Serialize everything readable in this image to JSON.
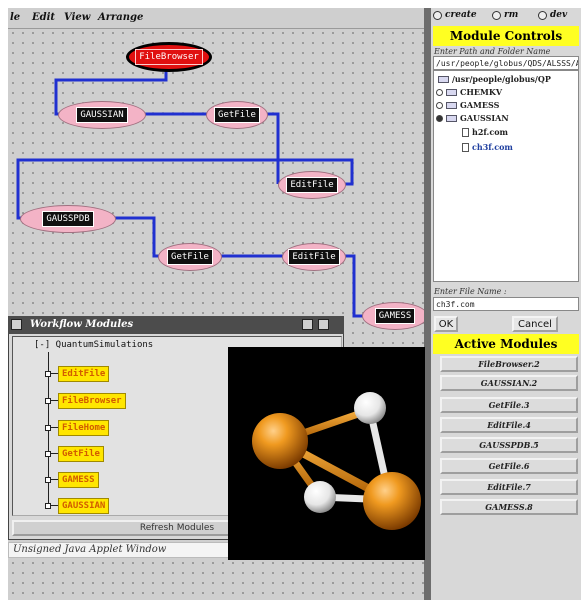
{
  "menubar": {
    "items": [
      "le",
      "Edit",
      "View",
      "Arrange"
    ]
  },
  "workflow_nodes": [
    {
      "id": "root",
      "label": "FileBrowser"
    },
    {
      "id": "n1",
      "label": "GAUSSIAN"
    },
    {
      "id": "n2",
      "label": "GetFile"
    },
    {
      "id": "n3",
      "label": "EditFile"
    },
    {
      "id": "n4",
      "label": "GAUSSPDB"
    },
    {
      "id": "n5",
      "label": "GetFile"
    },
    {
      "id": "n6",
      "label": "EditFile"
    },
    {
      "id": "n7",
      "label": "GAMESS"
    }
  ],
  "right_panel": {
    "radio_options": [
      "create",
      "rm",
      "dev"
    ],
    "module_controls_title": "Module Controls",
    "path_label": "Enter Path and Folder Name",
    "path_value": "/usr/people/globus/QDS/ALSSS/Ar",
    "tree": {
      "root": "/usr/people/globus/QP",
      "items": [
        "CHEMKV",
        "GAMESS",
        "GAUSSIAN"
      ],
      "files": [
        "h2f.com",
        "ch3f.com"
      ]
    },
    "file_label": "Enter File Name :",
    "file_value": "ch3f.com",
    "ok_label": "OK",
    "cancel_label": "Cancel",
    "active_modules_title": "Active Modules",
    "active_modules": [
      "FileBrowser.2",
      "GAUSSIAN.2",
      "GetFile.3",
      "EditFile.4",
      "GAUSSPDB.5",
      "GetFile.6",
      "EditFile.7",
      "GAMESS.8"
    ]
  },
  "workflow_window": {
    "title": "Workflow Modules",
    "root_item": "[-] QuantumSimulations",
    "modules": [
      "EditFile",
      "FileBrowser",
      "FileHome",
      "GetFile",
      "GAMESS",
      "GAUSSIAN"
    ],
    "refresh_label": "Refresh Modules"
  },
  "applet_status": "Unsigned Java Applet Window",
  "molecule": {
    "atoms": [
      "orange",
      "orange",
      "white",
      "white"
    ],
    "colors": {
      "heavy": "#e08a10",
      "light": "#f2f2f2",
      "bond": "#e08a10"
    }
  },
  "colors": {
    "wire": "#2030d0",
    "node": "#f3b3c6",
    "accent_yellow": "#ffff22",
    "module_yellow": "#ffe600"
  }
}
